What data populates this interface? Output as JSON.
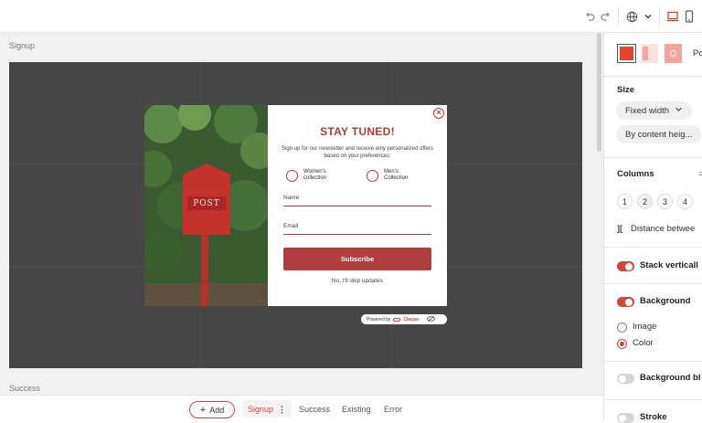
{
  "colors": {
    "accent": "#d3433f",
    "popup_red": "#b6393a",
    "canvas": "#464646"
  },
  "toolbar": {
    "icons": [
      "undo-icon",
      "redo-icon",
      "globe-icon",
      "chevron-down-icon",
      "desktop-icon",
      "mobile-icon"
    ]
  },
  "editor": {
    "stage_label": "Signup",
    "next_stage_label": "Success"
  },
  "popup": {
    "title": "STAY TUNED!",
    "subtitle": "Sign up for our newsletter and receive only personalized offers based on your preferences:",
    "options": [
      {
        "line1": "Women's",
        "line2": "collection"
      },
      {
        "line1": "Men's",
        "line2": "Collection"
      }
    ],
    "name_placeholder": "Name",
    "email_placeholder": "Email",
    "subscribe_label": "Subscribe",
    "skip_label": "No, I'll skip updates",
    "photo_text": "POST",
    "powered_prefix": "Powered by",
    "powered_brand": "Claspo"
  },
  "bottom": {
    "add_label": "Add",
    "tabs": [
      "Signup",
      "Success",
      "Existing",
      "Error"
    ]
  },
  "panel": {
    "position_label": "Po",
    "size_heading": "Size",
    "width_mode": "Fixed width",
    "height_mode": "By content heig...",
    "columns_heading": "Columns",
    "column_counts": [
      "1",
      "2",
      "3",
      "4"
    ],
    "distance_label": "Distance betwee",
    "stack_label": "Stack verticall",
    "background_heading": "Background",
    "bg_options": [
      "Image",
      "Color"
    ],
    "bg_blur_label": "Background bl",
    "stroke_label": "Stroke"
  }
}
